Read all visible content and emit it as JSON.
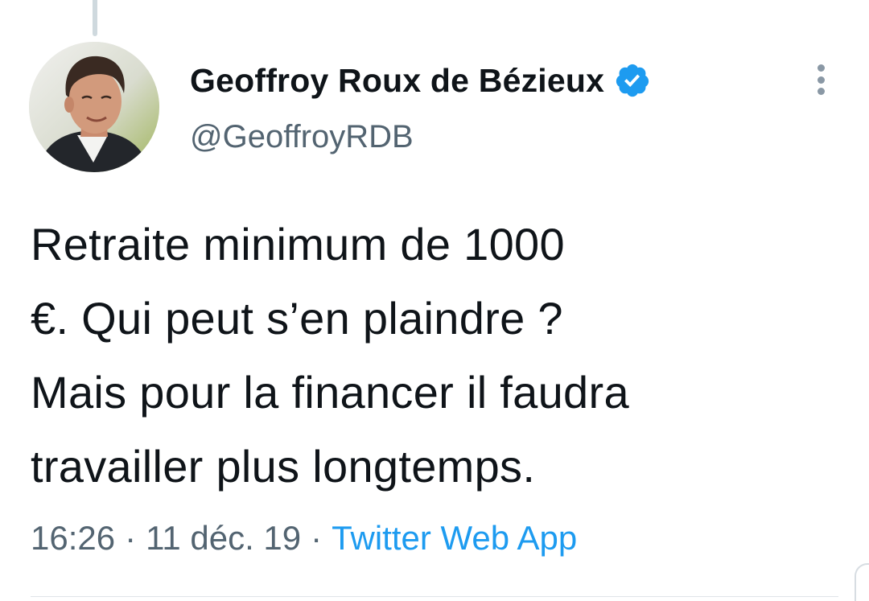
{
  "author": {
    "display_name": "Geoffroy Roux de Bézieux",
    "handle": "@GeoffroyRDB",
    "verified": true
  },
  "tweet": {
    "lines": [
      "Retraite minimum de 1000",
      "€. Qui peut s’en plaindre ?",
      "Mais pour la financer il faudra",
      "travailler plus longtemps."
    ]
  },
  "meta": {
    "time": "16:26",
    "separator": "·",
    "date": "11 déc. 19",
    "source": "Twitter Web App"
  },
  "icons": {
    "verified": "verified-badge-icon",
    "more": "more-vertical-icon"
  },
  "colors": {
    "text": "#0f1419",
    "secondary": "#536471",
    "accent": "#1d9bf0"
  }
}
